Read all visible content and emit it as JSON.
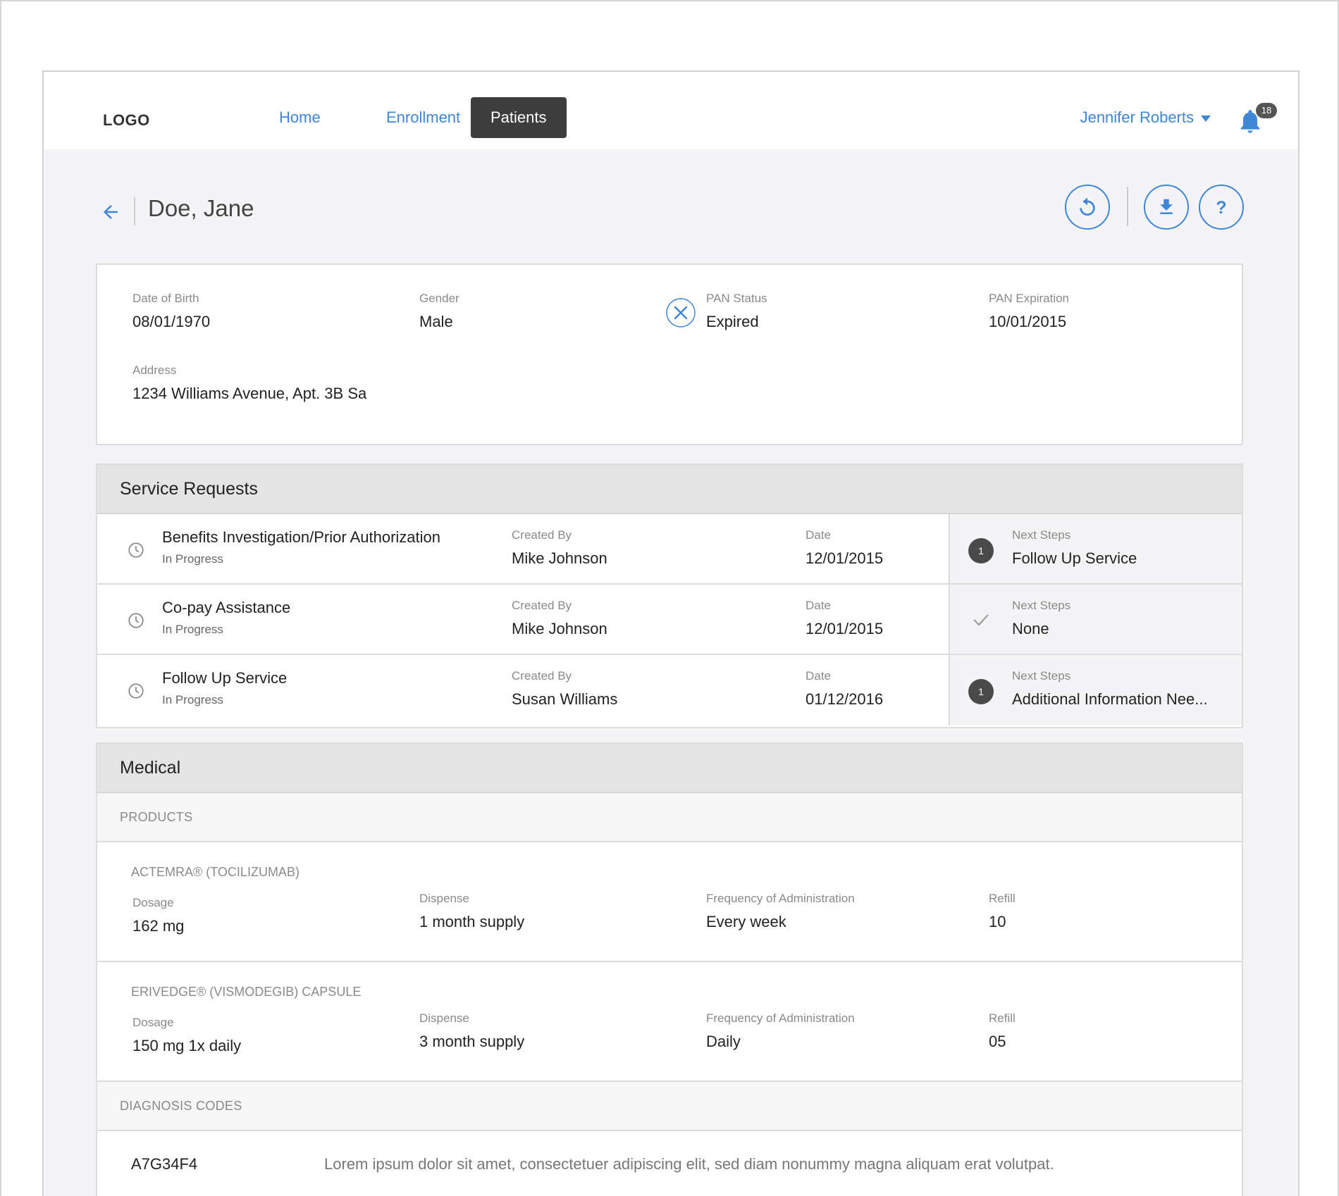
{
  "header": {
    "logo": "LOGO",
    "nav": [
      {
        "label": "Home",
        "active": false
      },
      {
        "label": "Enrollment",
        "active": false
      },
      {
        "label": "Patients",
        "active": true
      }
    ],
    "user_name": "Jennifer Roberts",
    "notification_count": "18",
    "accent_color": "#3f86d6"
  },
  "patient": {
    "name": "Doe, Jane",
    "dob_label": "Date of Birth",
    "dob": "08/01/1970",
    "gender_label": "Gender",
    "gender": "Male",
    "pan_status_label": "PAN Status",
    "pan_status": "Expired",
    "pan_exp_label": "PAN Expiration",
    "pan_exp": "10/01/2015",
    "address_label": "Address",
    "address": "1234 Williams Avenue, Apt. 3B  Sa"
  },
  "toolbar": {
    "icons": [
      "refresh-icon",
      "download-icon",
      "help-icon"
    ]
  },
  "service_requests": {
    "title": "Service Requests",
    "rows": [
      {
        "title": "Benefits Investigation/Prior Authorization",
        "status": "In Progress",
        "created_by_label": "Created By",
        "created_by": "Mike Johnson",
        "date_label": "Date",
        "date": "12/01/2015",
        "next_label": "Next Steps",
        "next": "Follow Up Service",
        "next_badge": "1"
      },
      {
        "title": "Co-pay Assistance",
        "status": "In Progress",
        "created_by_label": "Created By",
        "created_by": "Mike Johnson",
        "date_label": "Date",
        "date": "12/01/2015",
        "next_label": "Next Steps",
        "next": "None",
        "next_badge": ""
      },
      {
        "title": "Follow Up Service",
        "status": "In Progress",
        "created_by_label": "Created By",
        "created_by": "Susan Williams",
        "date_label": "Date",
        "date": "01/12/2016",
        "next_label": "Next Steps",
        "next": "Additional Information Nee...",
        "next_badge": "1"
      }
    ]
  },
  "medical": {
    "title": "Medical",
    "products_label": "PRODUCTS",
    "products": [
      {
        "name": "ACTEMRA® (TOCILIZUMAB)",
        "dosage_label": "Dosage",
        "dosage": "162 mg",
        "dispense_label": "Dispense",
        "dispense": "1 month supply",
        "freq_label": "Frequency of Administration",
        "freq": "Every week",
        "refill_label": "Refill",
        "refill": "10"
      },
      {
        "name": "ERIVEDGE® (VISMODEGIB) CAPSULE",
        "dosage_label": "Dosage",
        "dosage": "150 mg 1x daily",
        "dispense_label": "Dispense",
        "dispense": "3 month supply",
        "freq_label": "Frequency of Administration",
        "freq": "Daily",
        "refill_label": "Refill",
        "refill": "05"
      }
    ],
    "diagnosis_label": "DIAGNOSIS CODES",
    "diagnosis": [
      {
        "code": "A7G34F4",
        "description": "Lorem ipsum dolor sit amet, consectetuer adipiscing elit, sed diam nonummy magna aliquam erat volutpat."
      }
    ]
  }
}
